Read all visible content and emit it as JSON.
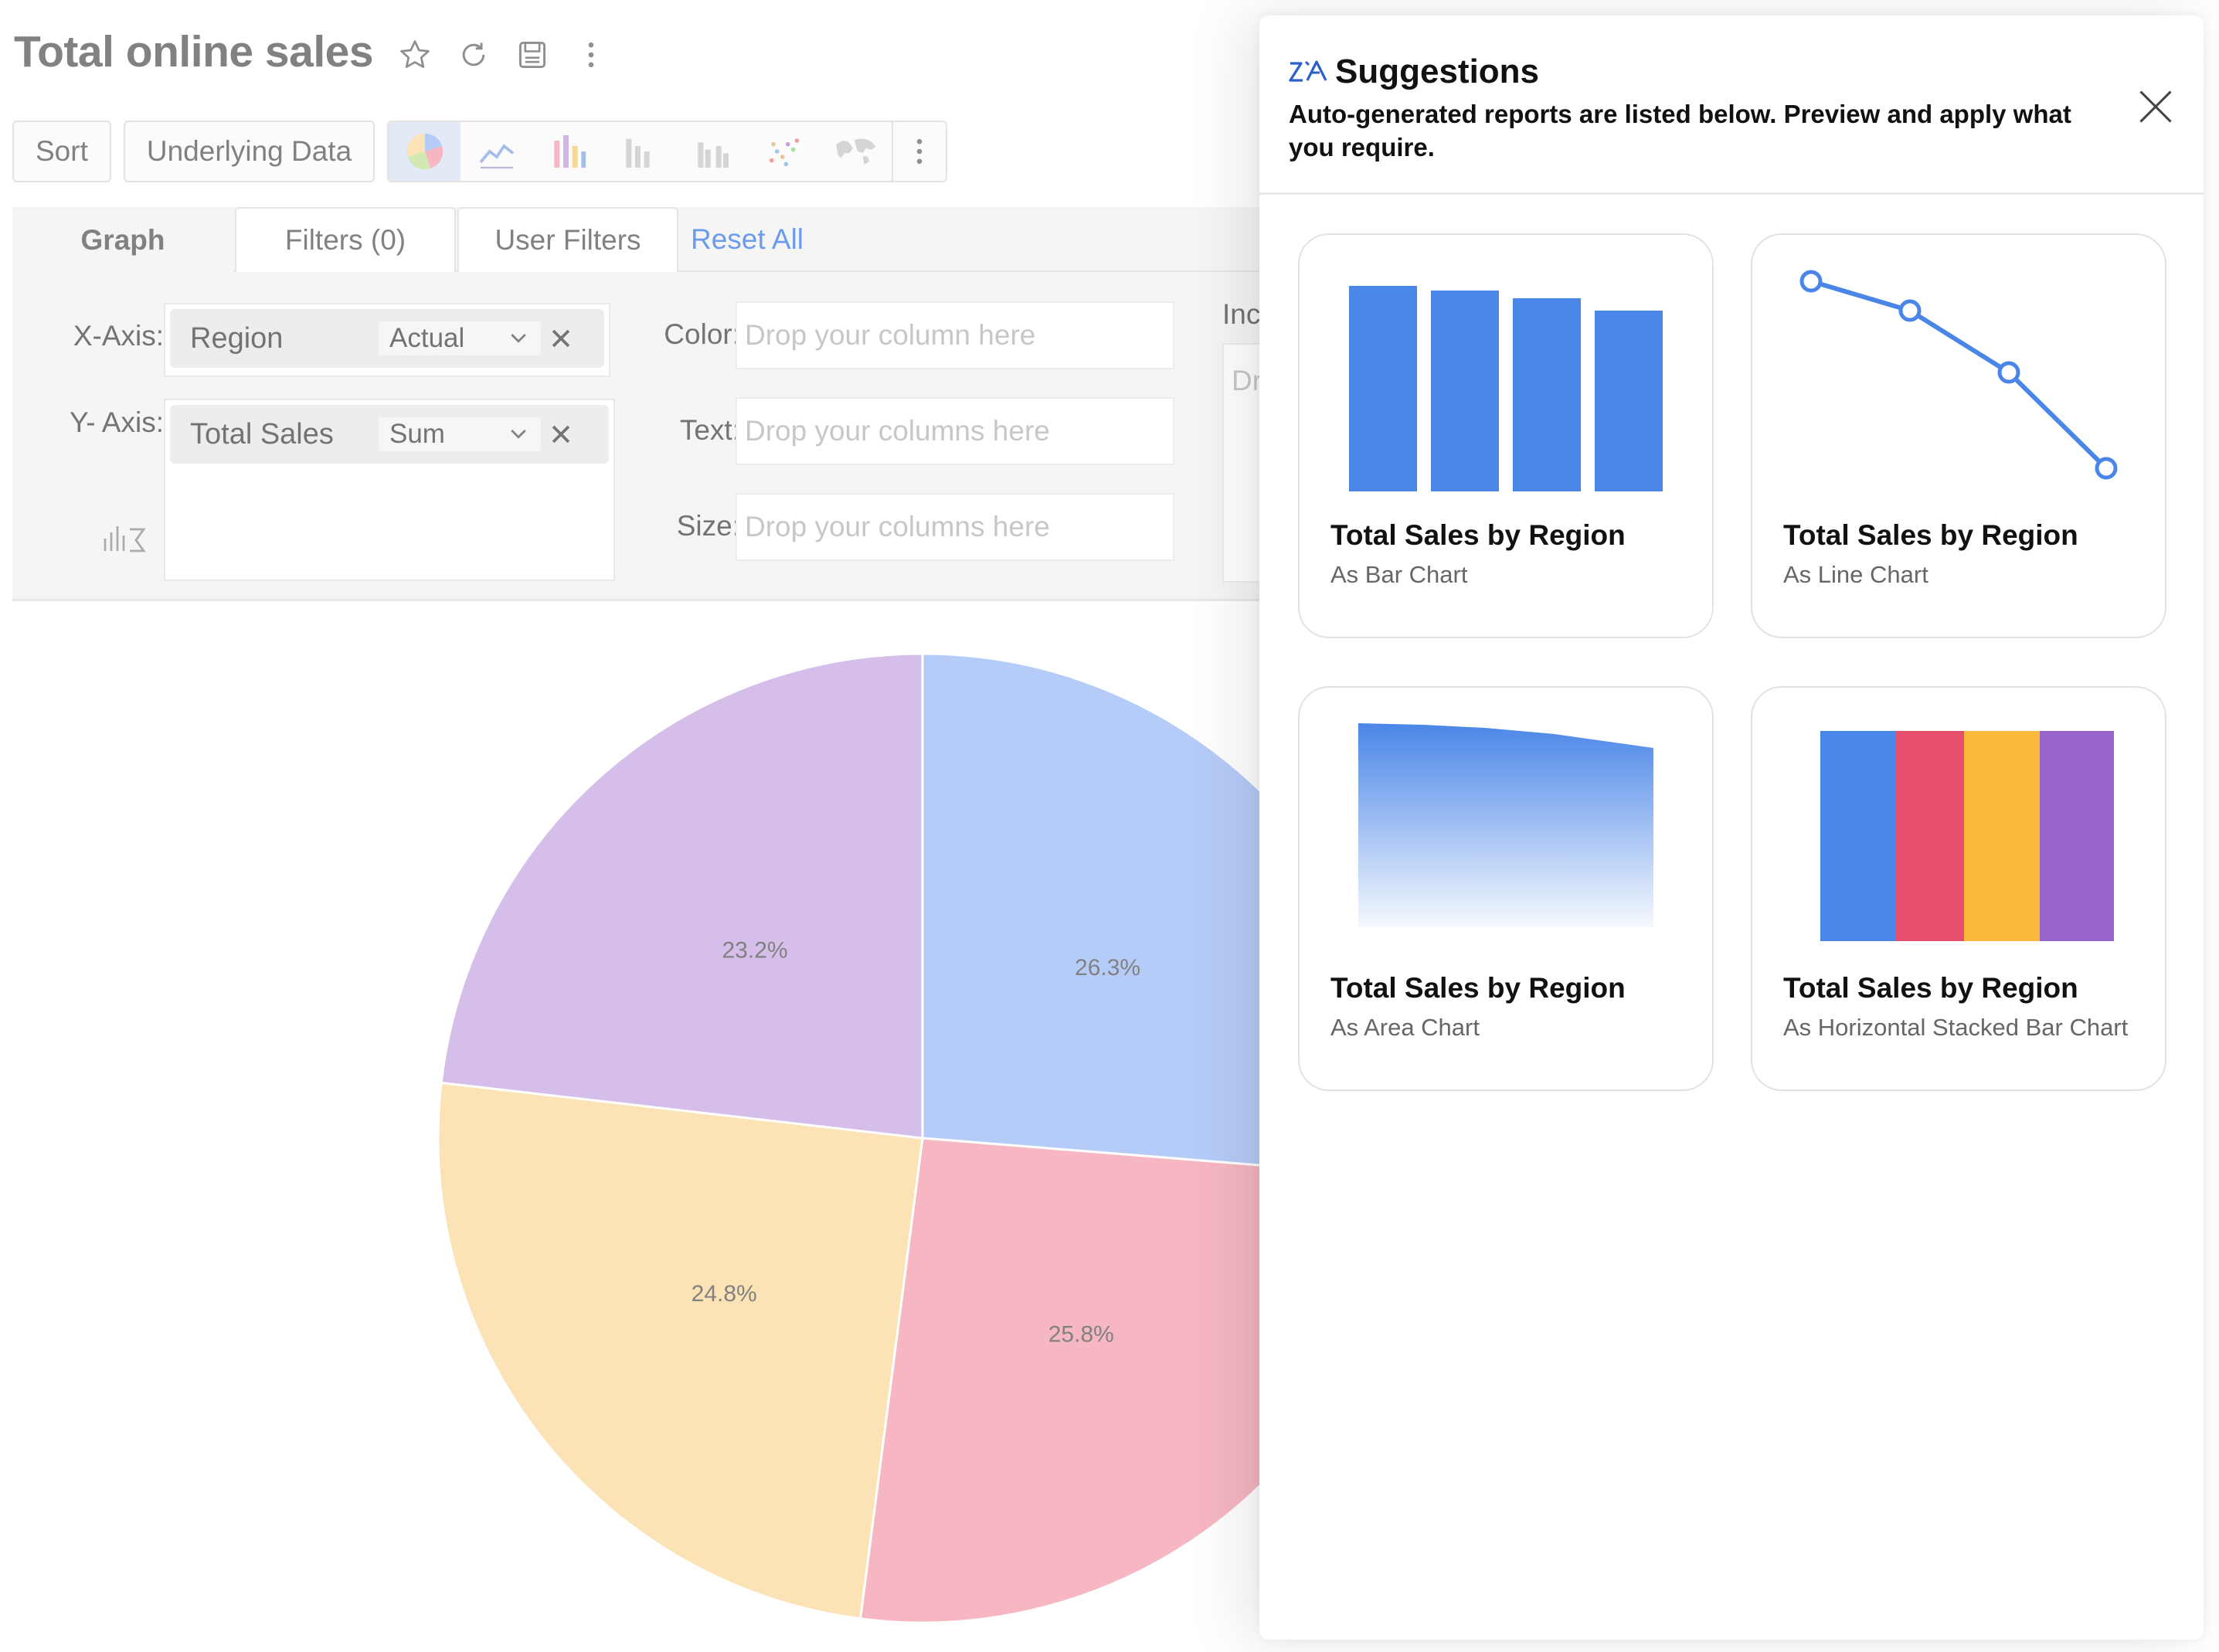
{
  "report": {
    "title": "Total online sales"
  },
  "toolbar": {
    "sort_label": "Sort",
    "underlying_label": "Underlying Data"
  },
  "tabs": {
    "graph": "Graph",
    "filters": "Filters  (0)",
    "user_filters": "User Filters",
    "reset_all": "Reset All"
  },
  "axes": {
    "x_label": "X-Axis:",
    "x_column": "Region",
    "x_agg": "Actual",
    "y_label": "Y- Axis:",
    "y_column": "Total Sales",
    "y_agg": "Sum",
    "color_label": "Color:",
    "color_placeholder": "Drop your column here",
    "text_label": "Text:",
    "text_placeholder": "Drop your columns here",
    "size_label": "Size:",
    "size_placeholder": "Drop your columns here",
    "partial_label": "Inc",
    "partial_placeholder": "Dr"
  },
  "chart_data": {
    "type": "pie",
    "categories": [
      "",
      "",
      "",
      ""
    ],
    "values": [
      26.3,
      25.8,
      24.8,
      23.2
    ],
    "labels": [
      "26.3%",
      "25.8%",
      "24.8%",
      "23.2%"
    ],
    "colors": [
      "#a7c1f7",
      "#f4a8b5",
      "#fbdda5",
      "#ccb1e6"
    ]
  },
  "suggestions": {
    "title": "Suggestions",
    "description": "Auto-generated reports are listed below. Preview and apply what you require.",
    "cards": [
      {
        "title": "Total Sales by Region",
        "subtitle": "As Bar Chart"
      },
      {
        "title": "Total Sales by Region",
        "subtitle": "As Line Chart"
      },
      {
        "title": "Total Sales by Region",
        "subtitle": "As Area Chart"
      },
      {
        "title": "Total Sales by Region",
        "subtitle": "As Horizontal Stacked Bar Chart"
      }
    ],
    "colors": {
      "blue": "#4a86e8",
      "red": "#e84f6c",
      "yellow": "#f9ba3b",
      "purple": "#9965cb"
    }
  }
}
